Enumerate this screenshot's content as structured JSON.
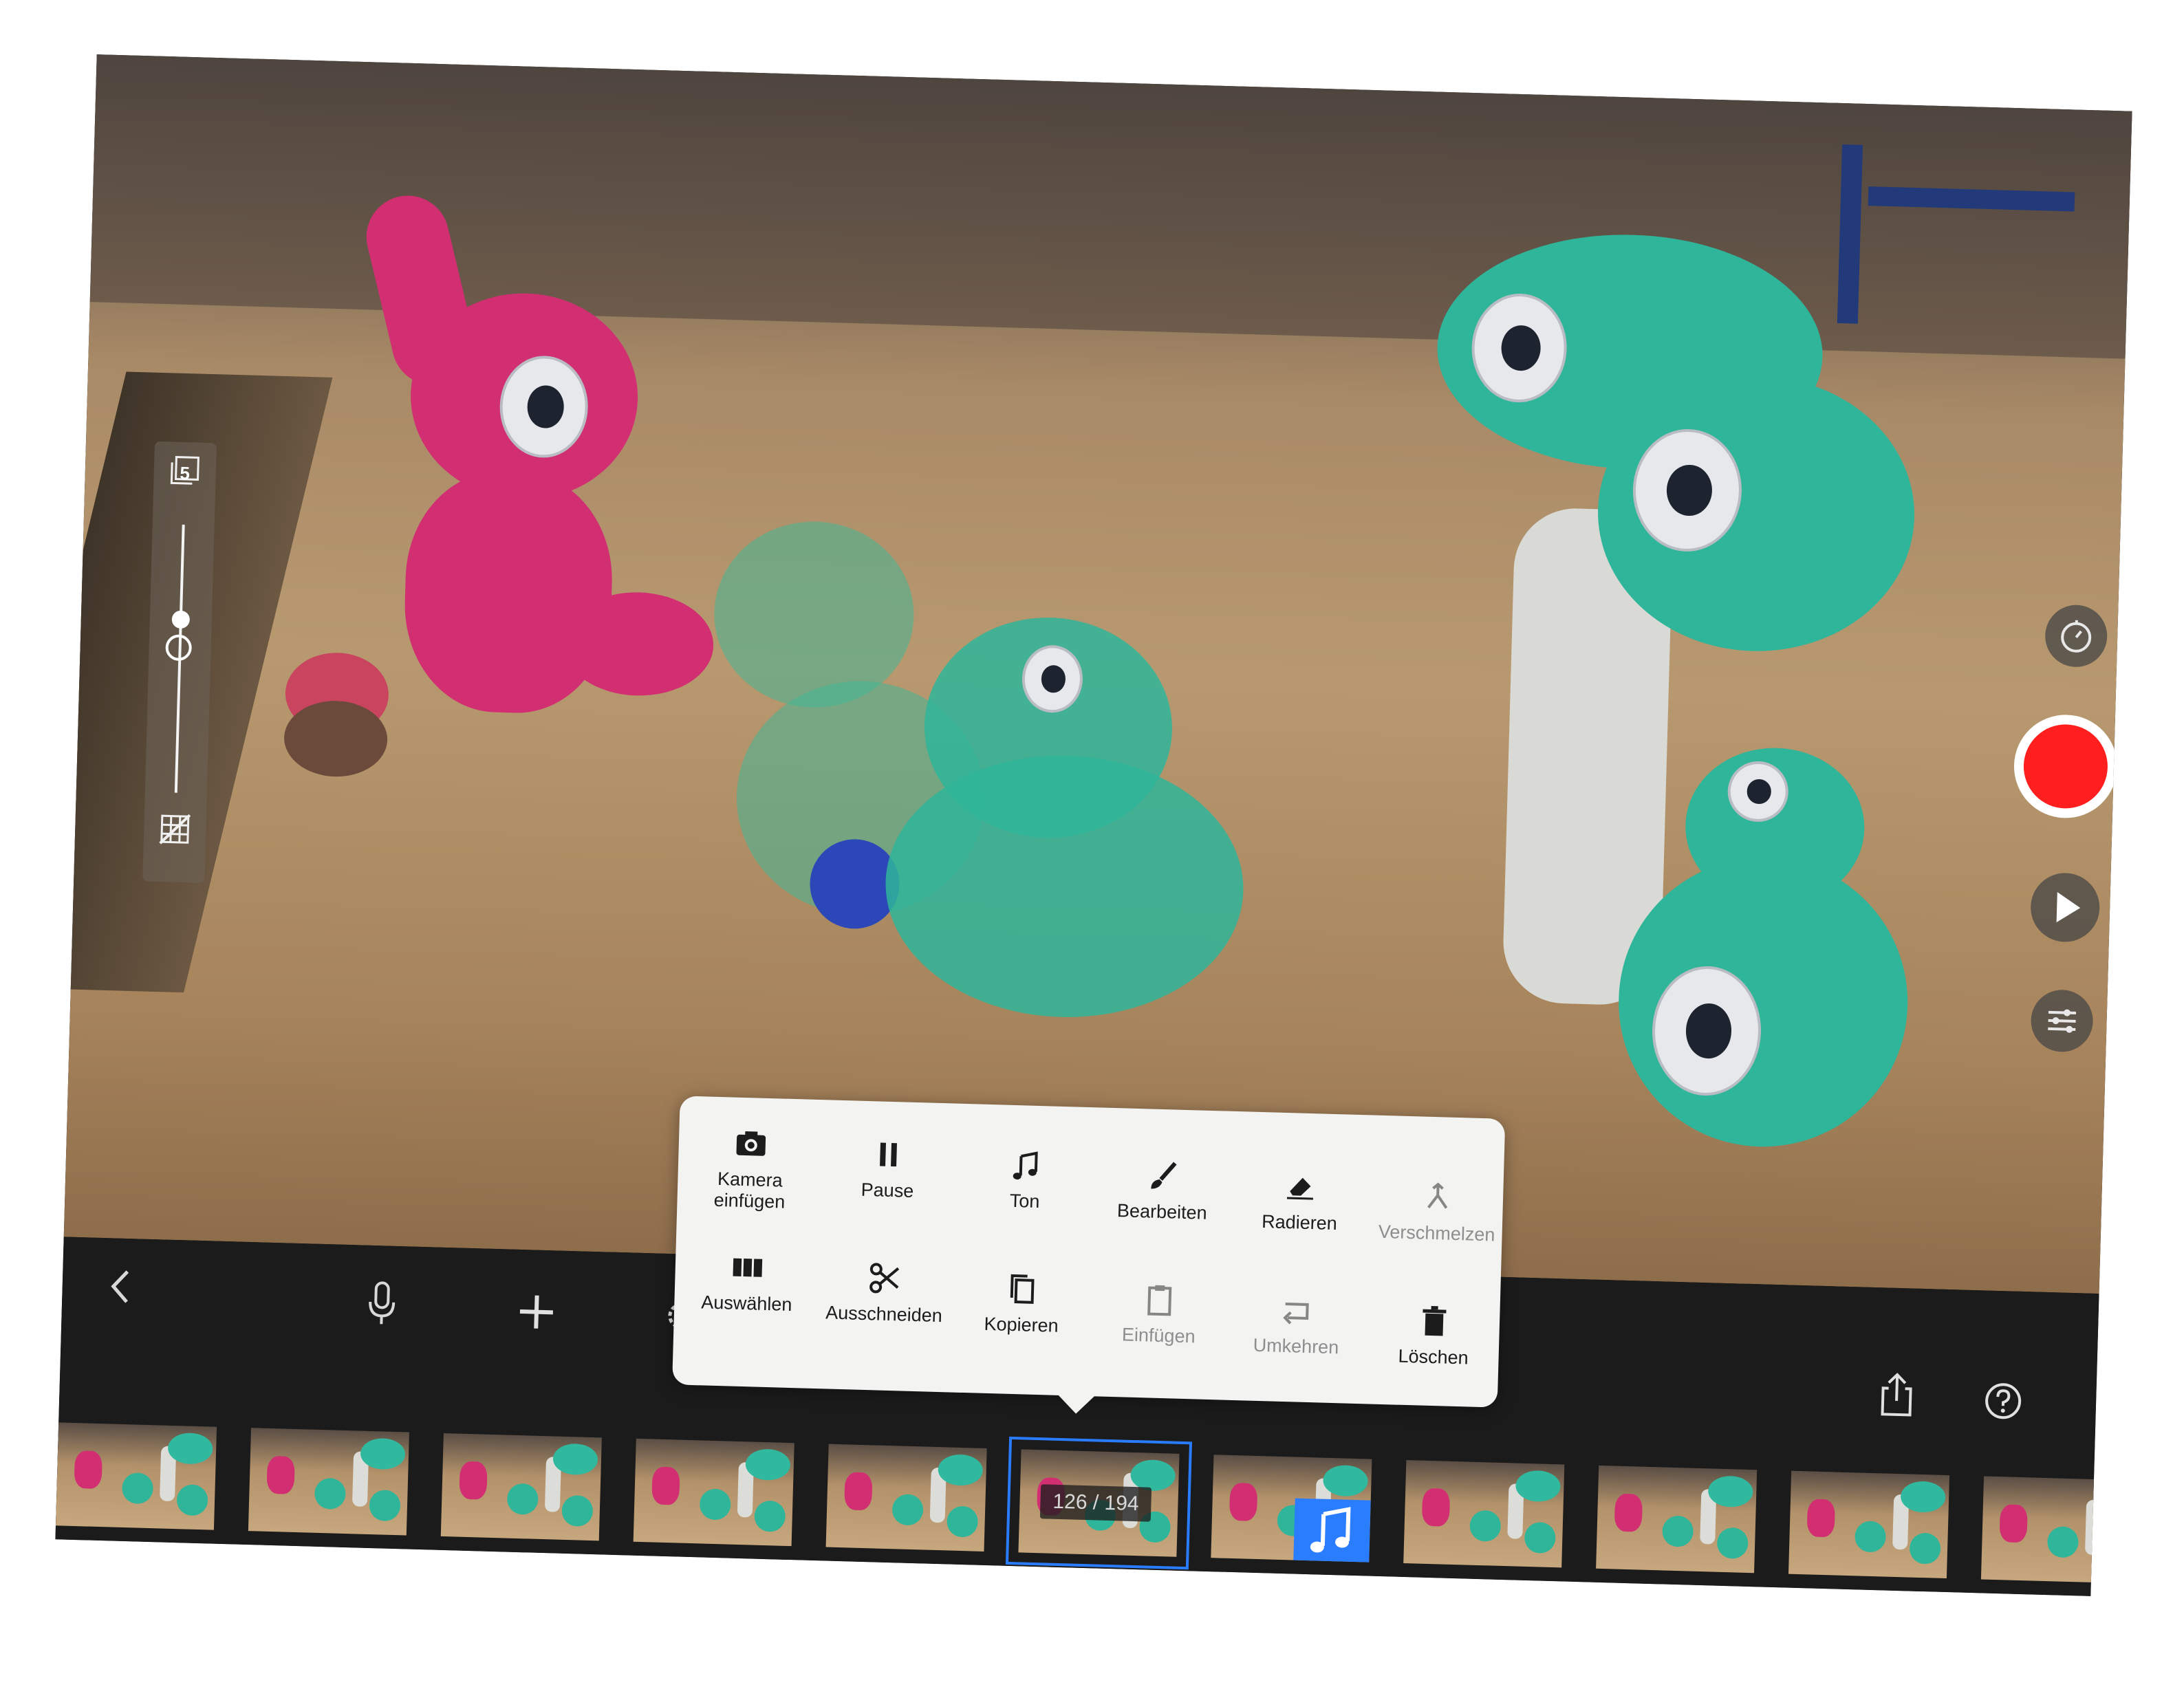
{
  "onion_skin": {
    "frame_count": "5",
    "opacity_level": 0.35
  },
  "camera_controls": {
    "timer_icon": "timer-icon",
    "record_color": "#ff1f1f",
    "play_icon": "play-icon",
    "settings_icon": "sliders-icon"
  },
  "toolbar": {
    "back_icon": "chevron-left-icon",
    "mic_icon": "microphone-icon",
    "add_icon": "plus-icon",
    "settings_icon": "gear-icon",
    "share_icon": "share-icon",
    "help_icon": "help-icon"
  },
  "popup_menu": {
    "row1": [
      {
        "label": "Kamera einfügen",
        "icon": "camera-icon",
        "enabled": true
      },
      {
        "label": "Pause",
        "icon": "pause-icon",
        "enabled": true
      },
      {
        "label": "Ton",
        "icon": "music-note-icon",
        "enabled": true
      },
      {
        "label": "Bearbeiten",
        "icon": "brush-icon",
        "enabled": true
      },
      {
        "label": "Radieren",
        "icon": "eraser-icon",
        "enabled": true
      },
      {
        "label": "Verschmelzen",
        "icon": "merge-icon",
        "enabled": false
      }
    ],
    "row2": [
      {
        "label": "Auswählen",
        "icon": "select-icon",
        "enabled": true
      },
      {
        "label": "Ausschneiden",
        "icon": "scissors-icon",
        "enabled": true
      },
      {
        "label": "Kopieren",
        "icon": "copy-icon",
        "enabled": true
      },
      {
        "label": "Einfügen",
        "icon": "paste-icon",
        "enabled": false
      },
      {
        "label": "Umkehren",
        "icon": "reverse-icon",
        "enabled": false
      },
      {
        "label": "Löschen",
        "icon": "trash-icon",
        "enabled": true
      }
    ]
  },
  "filmstrip": {
    "frame_counter": "126 / 194",
    "selected_index": 5,
    "music_frame_index": 6,
    "accent_color": "#2a7cff"
  }
}
